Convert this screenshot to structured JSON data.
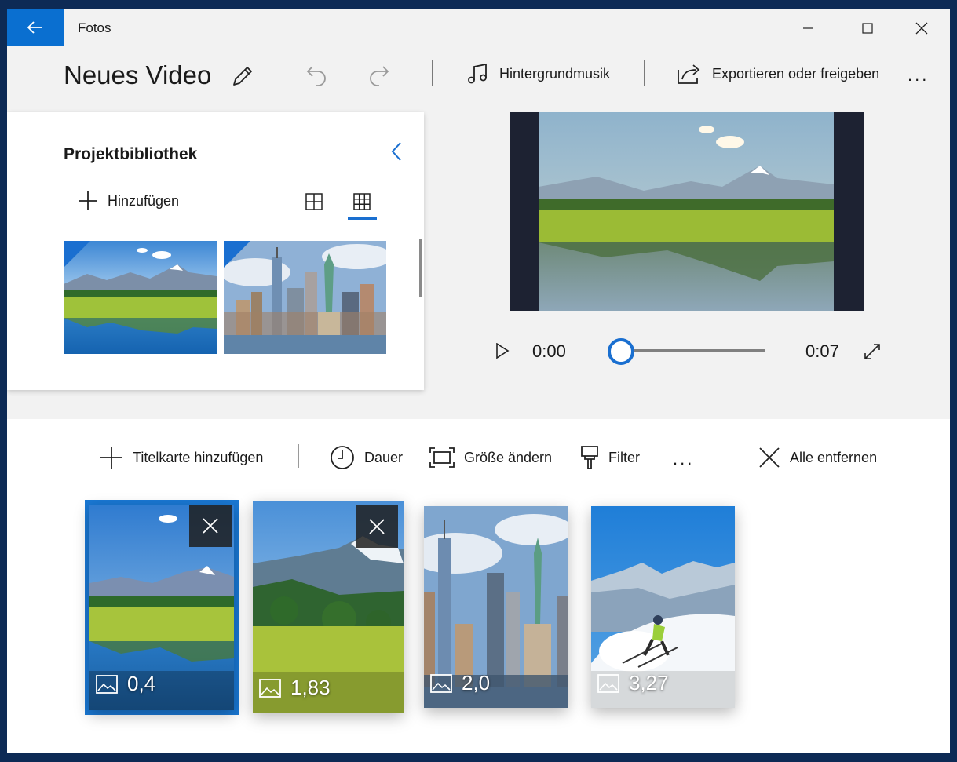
{
  "window": {
    "app_title": "Fotos"
  },
  "toolbar": {
    "project_title": "Neues Video",
    "music_label": "Hintergrundmusik",
    "export_label": "Exportieren oder freigeben",
    "more_label": "..."
  },
  "library": {
    "title": "Projektbibliothek",
    "add_label": "Hinzufügen"
  },
  "player": {
    "current_time": "0:00",
    "total_time": "0:07",
    "position": 0
  },
  "storyboard": {
    "add_title_card": "Titelkarte hinzufügen",
    "duration": "Dauer",
    "resize": "Größe ändern",
    "filter": "Filter",
    "more": "...",
    "remove_all": "Alle entfernen",
    "clips": [
      {
        "duration": "0,4",
        "scene": "alpine-lake"
      },
      {
        "duration": "1,83",
        "scene": "alpine-meadow"
      },
      {
        "duration": "2,0",
        "scene": "new-york"
      },
      {
        "duration": "3,27",
        "scene": "skier"
      }
    ]
  },
  "colors": {
    "accent": "#1a6fd0",
    "back_button": "#0a6fd0"
  }
}
